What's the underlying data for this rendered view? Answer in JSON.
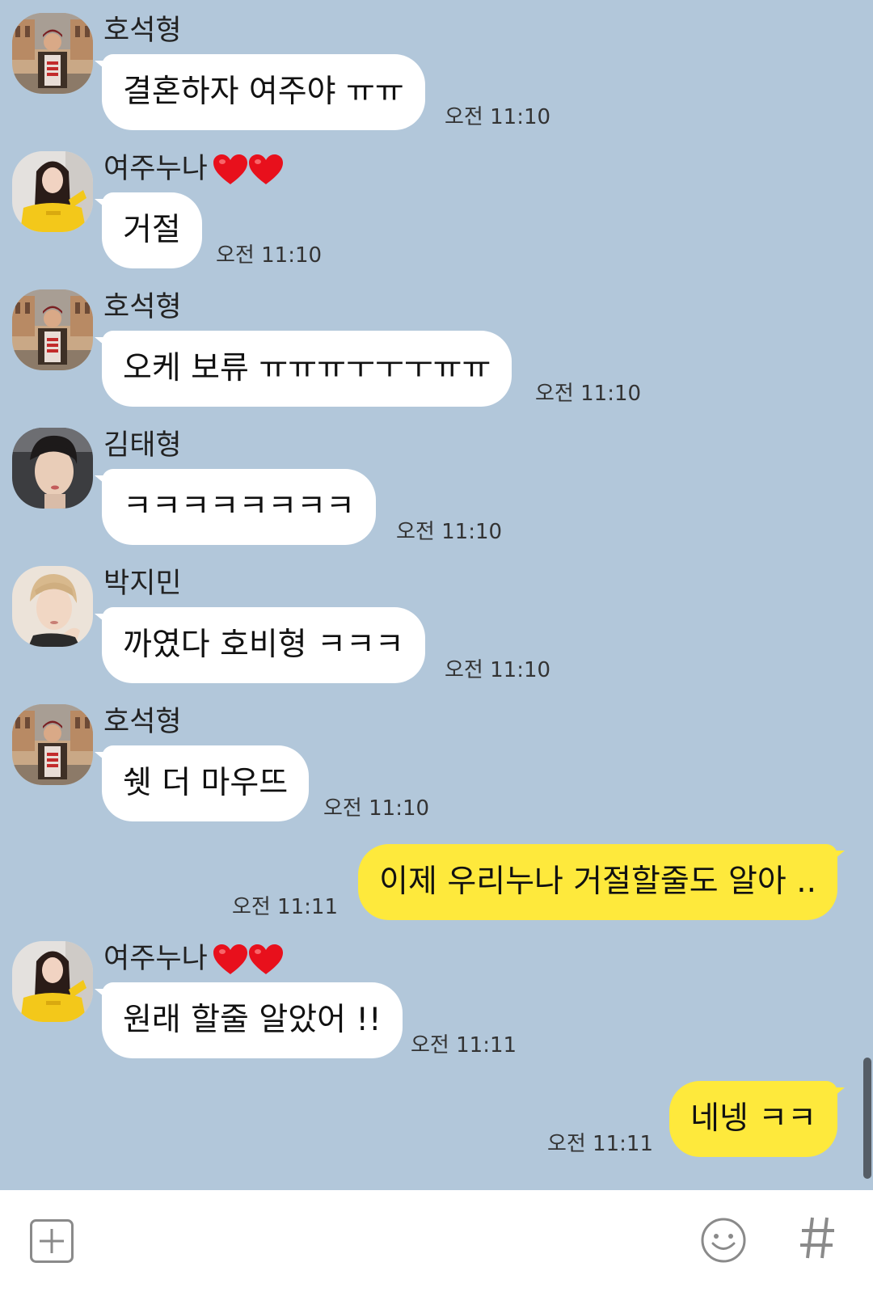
{
  "chat": {
    "messages": [
      {
        "sender": "호석형",
        "text": "결혼하자 여주야 ㅠㅠ",
        "time": "오전 11:10"
      },
      {
        "sender": "여주누나",
        "text": "거절",
        "time": "오전 11:10"
      },
      {
        "sender": "호석형",
        "text": "오케 보류 ㅠㅠㅠㅜㅜㅜㅠㅠ",
        "time": "오전 11:10"
      },
      {
        "sender": "김태형",
        "text": "ㅋㅋㅋㅋㅋㅋㅋㅋ",
        "time": "오전 11:10"
      },
      {
        "sender": "박지민",
        "text": "까였다 호비형 ㅋㅋㅋ",
        "time": "오전 11:10"
      },
      {
        "sender": "호석형",
        "text": "쉣 더 마우뜨",
        "time": "오전 11:10"
      },
      {
        "sender": "",
        "text": "이제 우리누나 거절할줄도 알아 ..",
        "time": "오전 11:11"
      },
      {
        "sender": "여주누나",
        "text": "원래 할줄 알았어 !!",
        "time": "오전 11:11"
      },
      {
        "sender": "",
        "text": "네넹 ㅋㅋ",
        "time": "오전 11:11"
      }
    ]
  },
  "bottom_bar": {
    "icons": [
      "plus-box-icon",
      "smiley-icon",
      "hash-icon"
    ]
  },
  "colors": {
    "chat_background": "#b2c7da",
    "incoming_bubble": "#ffffff",
    "outgoing_bubble": "#fee93c",
    "heart": "#e8101c"
  }
}
